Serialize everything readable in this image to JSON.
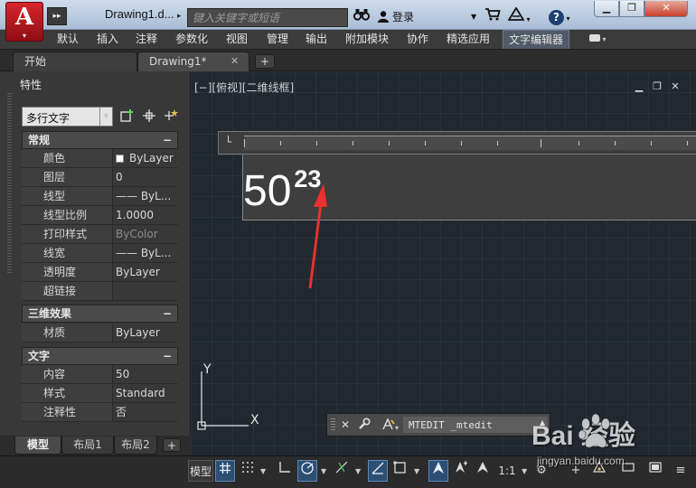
{
  "titlebar": {
    "app_letter": "A",
    "doc_title": "Drawing1.d...",
    "search_placeholder": "键入关键字或短语",
    "login_label": "登录",
    "help_icon": "?"
  },
  "ribbon": {
    "tabs": [
      "默认",
      "插入",
      "注释",
      "参数化",
      "视图",
      "管理",
      "输出",
      "附加模块",
      "协作",
      "精选应用",
      "文字编辑器"
    ],
    "active_tab": "文字编辑器"
  },
  "doc_tabs": {
    "start": "开始",
    "drawing": "Drawing1*",
    "close_glyph": "✕",
    "new_glyph": "+"
  },
  "properties": {
    "title": "特性",
    "object_type": "多行文字",
    "groups": [
      {
        "name": "常规",
        "rows": [
          {
            "label": "颜色",
            "value": "ByLayer"
          },
          {
            "label": "图层",
            "value": "0"
          },
          {
            "label": "线型",
            "value": "—— ByL..."
          },
          {
            "label": "线型比例",
            "value": "1.0000"
          },
          {
            "label": "打印样式",
            "value": "ByColor"
          },
          {
            "label": "线宽",
            "value": "—— ByL..."
          },
          {
            "label": "透明度",
            "value": "ByLayer"
          },
          {
            "label": "超链接",
            "value": ""
          }
        ]
      },
      {
        "name": "三维效果",
        "rows": [
          {
            "label": "材质",
            "value": "ByLayer"
          }
        ]
      },
      {
        "name": "文字",
        "rows": [
          {
            "label": "内容",
            "value": "50"
          },
          {
            "label": "样式",
            "value": "Standard"
          },
          {
            "label": "注释性",
            "value": "否"
          }
        ]
      }
    ],
    "collapse_glyph": "−"
  },
  "viewport": {
    "label": "[−][俯视][二维线框]",
    "mtext_base": "50",
    "mtext_superscript": "23",
    "ucs_y": "Y",
    "ucs_x": "X",
    "colors": {
      "background": "#212830",
      "arrow": "#e8322f"
    }
  },
  "command": {
    "value": "MTEDIT _mtedit"
  },
  "layout_tabs": [
    "模型",
    "布局1",
    "布局2"
  ],
  "statusbar": {
    "model": "模型",
    "scale": "1:1"
  },
  "watermark": {
    "brand": "Bai  经验",
    "url": "jingyan.baidu.com"
  }
}
